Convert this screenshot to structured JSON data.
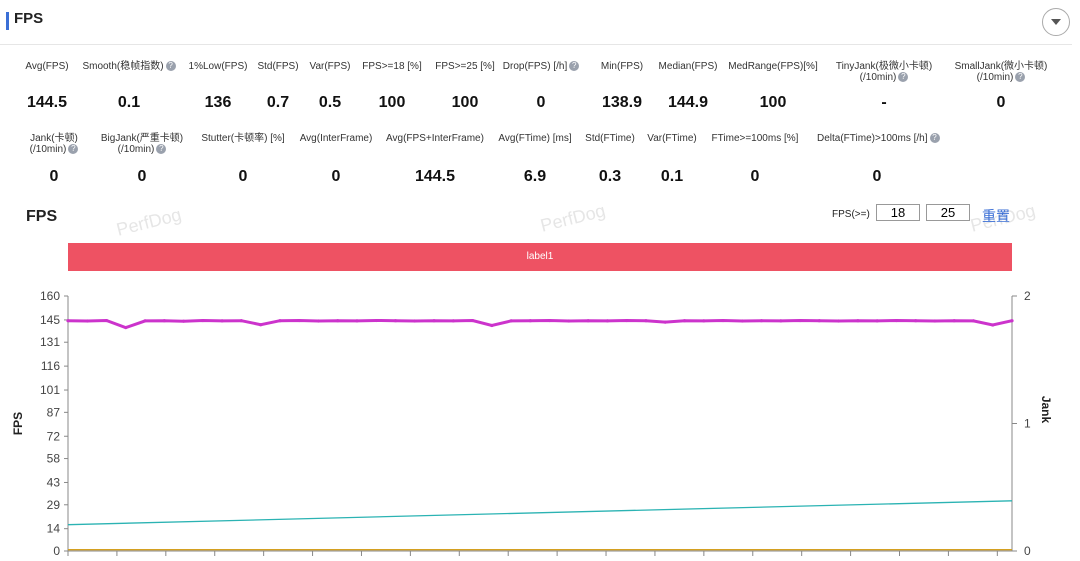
{
  "header": {
    "title": "FPS"
  },
  "metrics_row1": [
    {
      "label": "Avg(FPS)",
      "value": "144.5",
      "help": false
    },
    {
      "label": "Smooth(稳帧指数)",
      "value": "0.1",
      "help": true
    },
    {
      "label": "1%Low(FPS)",
      "value": "136",
      "help": false
    },
    {
      "label": "Std(FPS)",
      "value": "0.7",
      "help": false
    },
    {
      "label": "Var(FPS)",
      "value": "0.5",
      "help": false
    },
    {
      "label": "FPS>=18 [%]",
      "value": "100",
      "help": false
    },
    {
      "label": "FPS>=25 [%]",
      "value": "100",
      "help": false
    },
    {
      "label": "Drop(FPS) [/h]",
      "value": "0",
      "help": true
    },
    {
      "label": "Min(FPS)",
      "value": "138.9",
      "help": false
    },
    {
      "label": "Median(FPS)",
      "value": "144.9",
      "help": false
    },
    {
      "label": "MedRange(FPS)[%]",
      "value": "100",
      "help": false
    },
    {
      "label": "TinyJank(极微小卡顿)",
      "label2": "(/10min)",
      "value": "-",
      "help": true
    },
    {
      "label": "SmallJank(微小卡顿)",
      "label2": "(/10min)",
      "value": "0",
      "help": true
    }
  ],
  "metrics_row2": [
    {
      "label": "Jank(卡顿)",
      "label2": "(/10min)",
      "value": "0",
      "help": true
    },
    {
      "label": "BigJank(严重卡顿)",
      "label2": "(/10min)",
      "value": "0",
      "help": true
    },
    {
      "label": "Stutter(卡顿率) [%]",
      "value": "0",
      "help": false
    },
    {
      "label": "Avg(InterFrame)",
      "value": "0",
      "help": false
    },
    {
      "label": "Avg(FPS+InterFrame)",
      "value": "144.5",
      "help": false
    },
    {
      "label": "Avg(FTime) [ms]",
      "value": "6.9",
      "help": false
    },
    {
      "label": "Std(FTime)",
      "value": "0.3",
      "help": false
    },
    {
      "label": "Var(FTime)",
      "value": "0.1",
      "help": false
    },
    {
      "label": "FTime>=100ms [%]",
      "value": "0",
      "help": false
    },
    {
      "label": "Delta(FTime)>100ms [/h]",
      "value": "0",
      "help": true
    }
  ],
  "chart_section": {
    "title": "FPS",
    "threshold_label": "FPS(>=)",
    "threshold_1": "18",
    "threshold_2": "25",
    "reset_label": "重置",
    "watermark": "PerfDog",
    "band_label": "label1"
  },
  "chart_data": {
    "type": "line",
    "ylabel": "FPS",
    "y2label": "Jank",
    "yticks": [
      "160",
      "145",
      "131",
      "116",
      "101",
      "87",
      "72",
      "58",
      "43",
      "29",
      "14",
      "0"
    ],
    "ylim": [
      0,
      160
    ],
    "y2ticks": [
      "2",
      "1",
      "0"
    ],
    "y2lim": [
      0,
      2
    ],
    "grid": false,
    "series": [
      {
        "values": [
          144.5,
          144.3,
          144.6,
          140.2,
          144.4,
          144.5,
          144.2,
          144.6,
          144.4,
          144.5,
          142.0,
          144.5,
          144.6,
          144.3,
          144.5,
          144.4,
          144.6,
          144.5,
          144.3,
          144.5,
          144.4,
          144.6,
          141.5,
          144.4,
          144.5,
          144.6,
          144.3,
          144.5,
          144.4,
          144.6,
          144.5,
          143.6,
          144.5,
          144.4,
          144.6,
          144.3,
          144.5,
          144.4,
          144.6,
          144.5,
          144.3,
          144.5,
          144.4,
          144.6,
          144.5,
          144.3,
          144.5,
          144.4,
          141.8,
          144.5
        ],
        "color": "#cc33cc"
      },
      {
        "values": [
          16.5,
          31.5
        ],
        "color": "#2bb3b3"
      },
      {
        "values": [
          0.8,
          0.8
        ],
        "color": "#d4a020"
      }
    ]
  },
  "colors": {
    "accent": "#3b6fd6",
    "band": "#ee5263",
    "fps_line": "#cc33cc",
    "jank_line": "#2bb3b3"
  }
}
